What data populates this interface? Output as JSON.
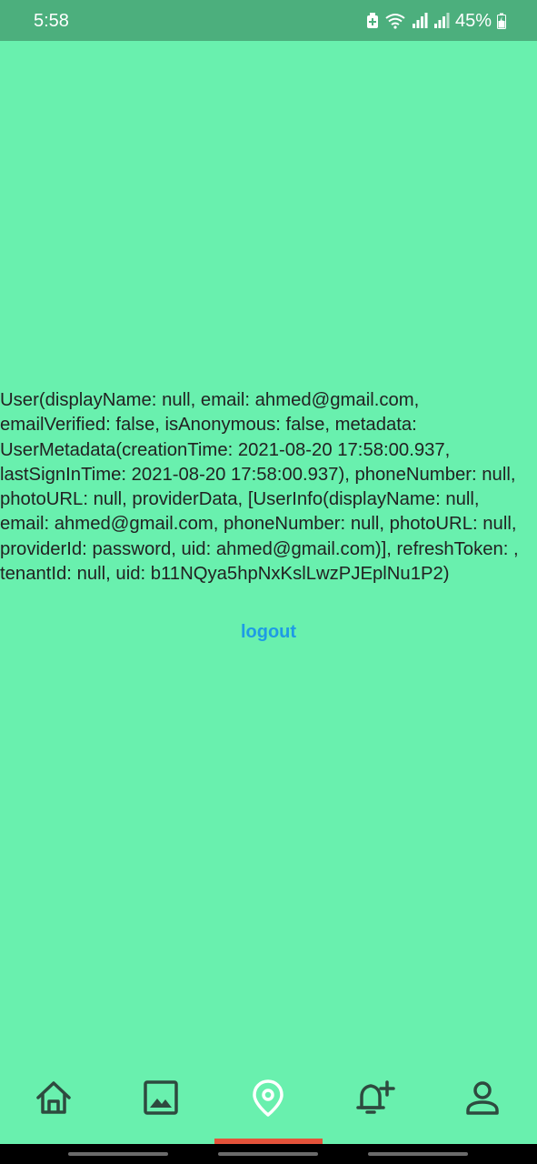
{
  "status_bar": {
    "time": "5:58",
    "battery_percent": "45%",
    "icons": [
      "battery-saver-icon",
      "wifi-icon",
      "signal-icon",
      "signal-icon",
      "battery-charging-icon"
    ]
  },
  "main": {
    "user_text": "User(displayName: null, email: ahmed@gmail.com, emailVerified: false, isAnonymous: false, metadata: UserMetadata(creationTime: 2021-08-20 17:58:00.937, lastSignInTime: 2021-08-20 17:58:00.937), phoneNumber: null, photoURL: null, providerData, [UserInfo(displayName: null, email: ahmed@gmail.com, phoneNumber: null, photoURL: null, providerId: password, uid: ahmed@gmail.com)], refreshToken: , tenantId: null, uid: b11NQya5hpNxKslLwzPJEplNu1P2)",
    "logout_label": "logout"
  },
  "bottom_nav": {
    "items": [
      {
        "icon": "home-icon",
        "active": false
      },
      {
        "icon": "image-icon",
        "active": false
      },
      {
        "icon": "location-pin-icon",
        "active": true
      },
      {
        "icon": "bell-add-icon",
        "active": false
      },
      {
        "icon": "person-icon",
        "active": false
      }
    ]
  },
  "colors": {
    "background": "#69F0AE",
    "status_bar": "#4CAF7D",
    "link": "#1E9BE5",
    "nav_icon": "#2E4A3F",
    "active_icon": "#FFFFFF",
    "active_indicator": "#E4533A"
  }
}
